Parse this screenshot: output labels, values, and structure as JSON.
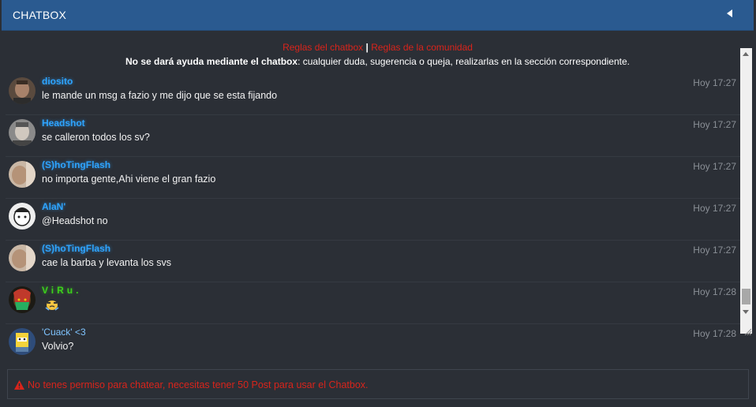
{
  "header": {
    "title": "CHATBOX"
  },
  "rules": {
    "chatbox_rules": "Reglas del chatbox",
    "separator": "|",
    "community_rules": "Reglas de la comunidad"
  },
  "notice": {
    "bold": "No se dará ayuda mediante el chatbox",
    "rest": ": cualquier duda, sugerencia o queja, realizarlas en la sección correspondiente."
  },
  "messages": [
    {
      "user": "diosito",
      "text": "le mande un msg a fazio y me dijo que se esta fijando",
      "time": "Hoy 17:27"
    },
    {
      "user": "Headshot",
      "text": "se calleron todos los sv?",
      "time": "Hoy 17:27"
    },
    {
      "user": "(S)hoTingFlash",
      "text": "no importa gente,Ahi viene el gran fazio",
      "time": "Hoy 17:27"
    },
    {
      "user": "AlaN'",
      "text": "@Headshot no",
      "time": "Hoy 17:27"
    },
    {
      "user": "(S)hoTingFlash",
      "text": "cae la barba y levanta los svs",
      "time": "Hoy 17:27"
    },
    {
      "user": "ViRu.",
      "text": "",
      "emoji": "crying-emoji",
      "time": "Hoy 17:28"
    },
    {
      "user": "'Cuack' <3",
      "text": "Volvio?",
      "time": "Hoy 17:28"
    }
  ],
  "footer": {
    "icon": "warning-icon",
    "message": "No tenes permiso para chatear, necesitas tener 50 Post para usar el Chatbox."
  },
  "colors": {
    "header_bg": "#2a5a90",
    "username_blue": "#2ea4ff",
    "username_green": "#3cd11c",
    "link_red": "#d9241b"
  }
}
